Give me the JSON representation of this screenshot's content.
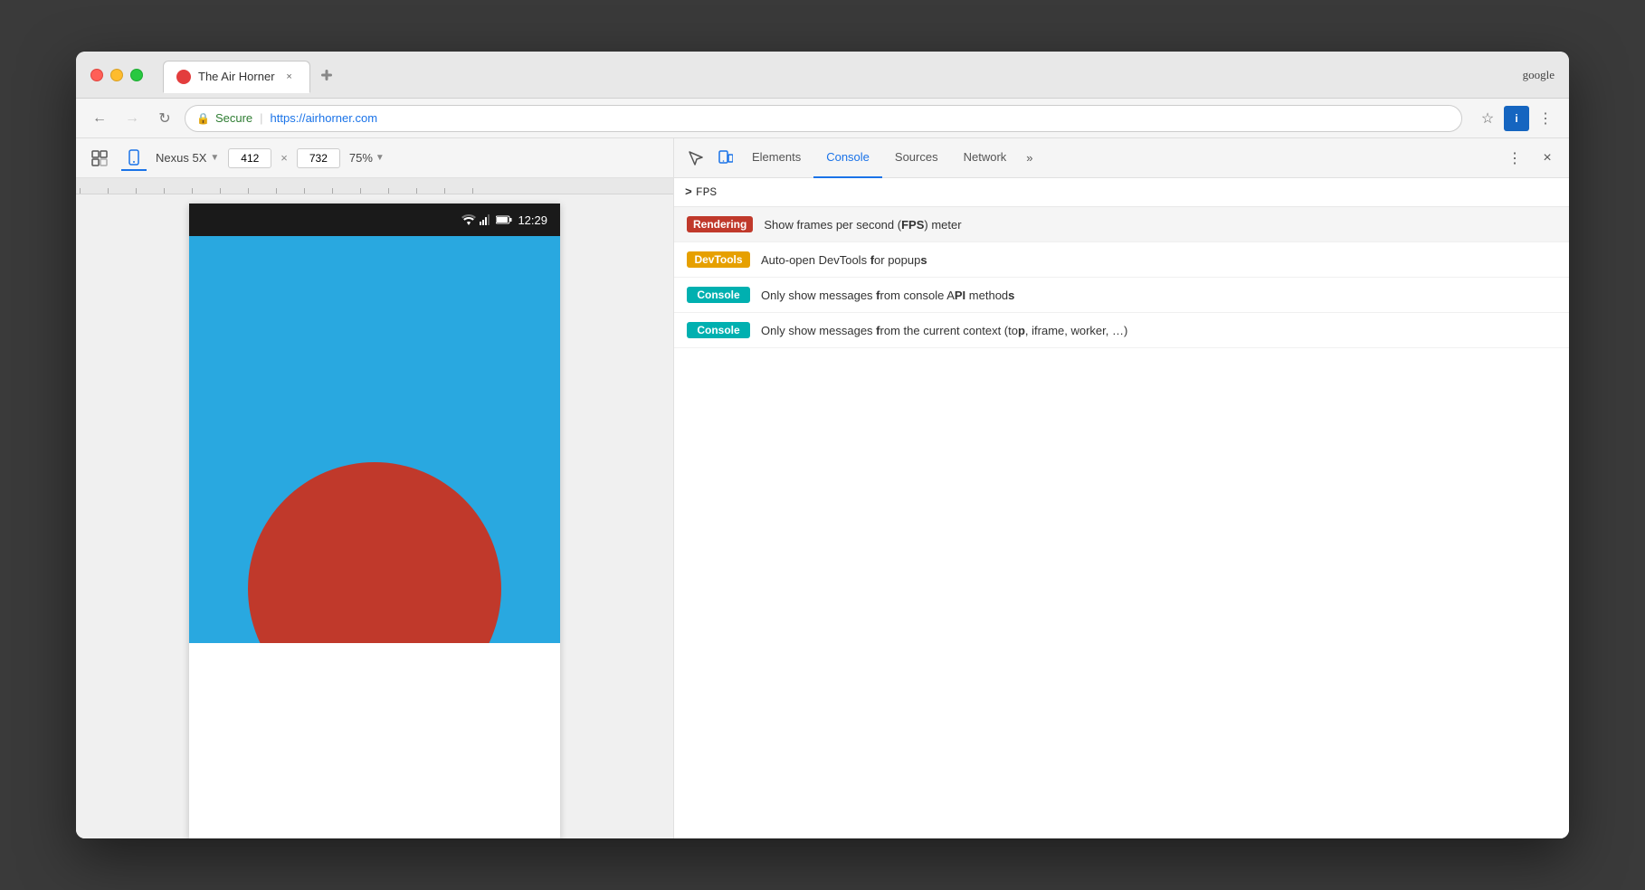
{
  "browser": {
    "title": "The Air Horner",
    "tab_title": "The Air Horner",
    "tab_close": "×",
    "new_tab": "+",
    "google_label": "google"
  },
  "nav": {
    "secure_label": "Secure",
    "url": "https://airhorner.com",
    "back_arrow": "←",
    "forward_arrow": "→",
    "reload": "↻"
  },
  "device_toolbar": {
    "device": "Nexus 5X",
    "width": "412",
    "height": "732",
    "zoom": "75%",
    "separator": "×"
  },
  "phone": {
    "time": "12:29"
  },
  "devtools": {
    "tabs": [
      "Elements",
      "Console",
      "Sources",
      "Network"
    ],
    "more": "»",
    "active_tab": "Console"
  },
  "console": {
    "prompt": ">",
    "input": "FPS"
  },
  "autocomplete": [
    {
      "badge": "Rendering",
      "badge_class": "badge-rendering",
      "text_parts": [
        "Show frames per second (",
        "FPS",
        ") meter"
      ],
      "bold_word": "FPS"
    },
    {
      "badge": "DevTools",
      "badge_class": "badge-devtools",
      "text_parts": [
        "Auto-open DevTools ",
        "f",
        "or popup",
        "s"
      ],
      "description": "Auto-open DevTools for popups"
    },
    {
      "badge": "Console",
      "badge_class": "badge-console",
      "text_parts": [
        "Only show messages ",
        "f",
        "rom console A",
        "PI",
        " method",
        "s"
      ],
      "description": "Only show messages from console API methods"
    },
    {
      "badge": "Console",
      "badge_class": "badge-console",
      "text_parts": [
        "Only show messages ",
        "f",
        "rom the current context (to",
        "p",
        ", iframe, worker, …"
      ],
      "description": "Only show messages from the current context (top, iframe, worker, …"
    }
  ],
  "colors": {
    "phone_bg": "#29a8e0",
    "horn_color": "#c0392b",
    "console_active": "#1a73e8",
    "rendering_badge": "#c0392b",
    "devtools_badge": "#e6a000",
    "console_badge": "#00b0b0"
  }
}
